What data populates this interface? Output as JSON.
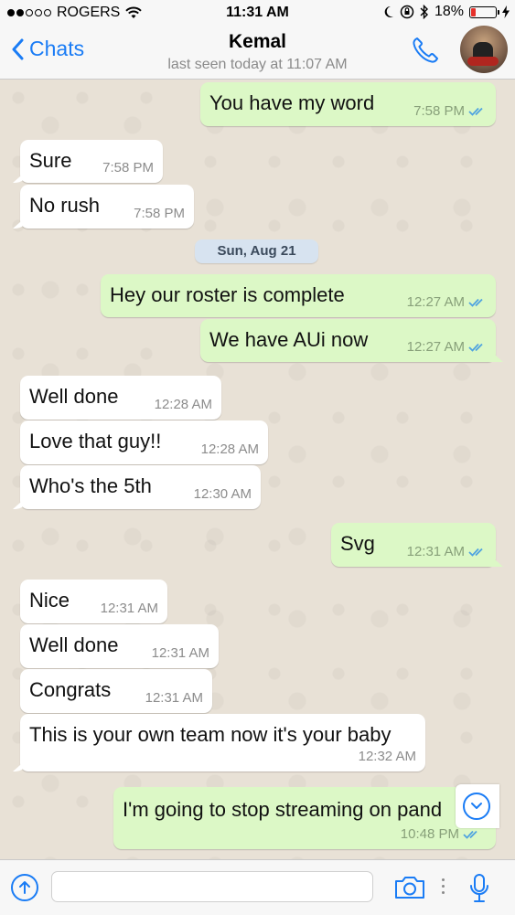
{
  "status": {
    "carrier": "ROGERS",
    "time": "11:31 AM",
    "battery": "18%",
    "battery_level": 0.18,
    "signal_bars_filled": 2,
    "signal_bars_total": 5
  },
  "header": {
    "back_label": "Chats",
    "contact_name": "Kemal",
    "last_seen": "last seen today at 11:07 AM",
    "call_icon": "phone-icon",
    "avatar_icon": "contact-avatar"
  },
  "conversation": {
    "date_divider": "Sun, Aug 21",
    "messages": [
      {
        "dir": "out",
        "text": "You have my word",
        "time": "7:58 PM",
        "read": true
      },
      {
        "dir": "in",
        "text": "Sure",
        "time": "7:58 PM"
      },
      {
        "dir": "in",
        "text": "No rush",
        "time": "7:58 PM"
      },
      {
        "dir": "out",
        "text": "Hey our roster is complete",
        "time": "12:27 AM",
        "read": true
      },
      {
        "dir": "out",
        "text": "We have AUi now",
        "time": "12:27 AM",
        "read": true
      },
      {
        "dir": "in",
        "text": "Well done",
        "time": "12:28 AM"
      },
      {
        "dir": "in",
        "text": "Love that guy!!",
        "time": "12:28 AM"
      },
      {
        "dir": "in",
        "text": "Who's the 5th",
        "time": "12:30 AM"
      },
      {
        "dir": "out",
        "text": "Svg",
        "time": "12:31 AM",
        "read": true
      },
      {
        "dir": "in",
        "text": "Nice",
        "time": "12:31 AM"
      },
      {
        "dir": "in",
        "text": "Well done",
        "time": "12:31 AM"
      },
      {
        "dir": "in",
        "text": "Congrats",
        "time": "12:31 AM"
      },
      {
        "dir": "in",
        "text": "This is your own team now it's your baby",
        "time": "12:32 AM"
      },
      {
        "dir": "out",
        "text": "I'm going to stop streaming on pand",
        "time": "10:48 PM",
        "read": true
      }
    ]
  },
  "composer": {
    "placeholder": "",
    "attach_icon": "upload-icon",
    "camera_icon": "camera-icon",
    "mic_icon": "microphone-icon"
  },
  "colors": {
    "accent": "#1a7cf5",
    "outgoing_bubble": "#dcf8c6",
    "incoming_bubble": "#ffffff",
    "read_ticks": "#4fa3e0"
  }
}
